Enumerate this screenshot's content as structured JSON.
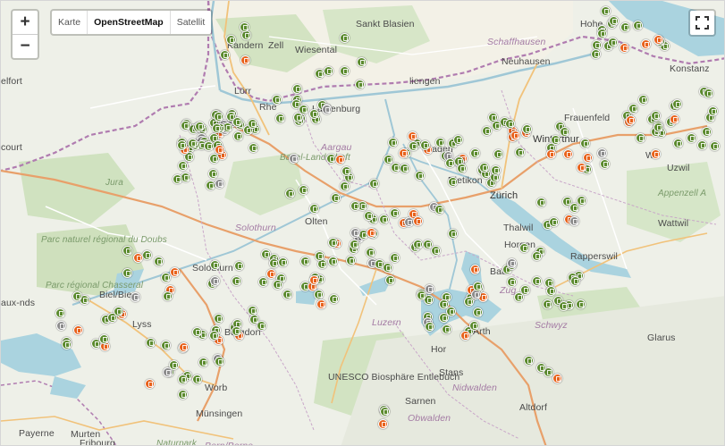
{
  "controls": {
    "zoom_in": "+",
    "zoom_out": "−",
    "layers": [
      "Karte",
      "OpenStreetMap",
      "Satellit"
    ],
    "active_layer": "OpenStreetMap",
    "fullscreen_icon": "fullscreen-icon"
  },
  "colors": {
    "marker_green": "#5b8a2e",
    "marker_orange": "#e8621c",
    "marker_gray": "#8c8c8c",
    "water": "#aad3df",
    "forest": "#cfe0bd",
    "border": "#b07cb0"
  },
  "place_labels": [
    "Kandern",
    "Zell",
    "Wiesental",
    "Sankt Blasien",
    "Schaffhausen",
    "Neuhausen",
    "Hohe",
    "Konstanz",
    "elfort",
    "Lörr",
    "Rhe",
    "Laufenburg",
    "Aargau",
    "liengen",
    "Frauenfeld",
    "Winterthur",
    "Wil",
    "Uzwil",
    "court",
    "Basel-Landschaft",
    "Baden",
    "Dietikon",
    "Zürich",
    "Jura",
    "Solothurn",
    "Olten",
    "Thalwil",
    "Horgen",
    "Appenzell A",
    "Wattwil",
    "Parc naturel régional du Doubs",
    "Solothurn",
    "Rapperswil",
    "Parc régional Chasseral",
    "Biel/Bie",
    "Baar",
    "Zug",
    "aux-nds",
    "Lyss",
    "Luzern",
    "Schwyz",
    "Burgdorf",
    "Glarus",
    "Arth",
    "Hor",
    "Stans",
    "Nidwalden",
    "Murten",
    "UNESCO Biosphäre Entlebuch",
    "Worb",
    "Münsingen",
    "Sarnen",
    "Obwalden",
    "Altdorf",
    "Payerne",
    "Fribourg",
    "Naturpark",
    "Bern/Berne"
  ],
  "markers": {
    "green": 280,
    "orange": 45,
    "gray": 15
  }
}
